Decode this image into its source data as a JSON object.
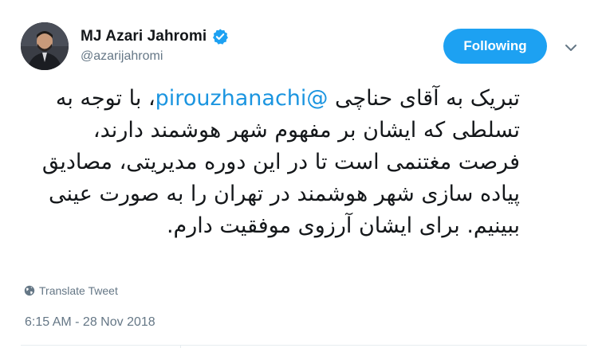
{
  "author": {
    "display_name": "MJ Azari Jahromi",
    "handle": "@azarijahromi",
    "verified": true,
    "verified_icon": "verified-badge-icon",
    "avatar_icon": "profile-photo"
  },
  "actions": {
    "follow_label": "Following",
    "menu_icon": "chevron-down-icon"
  },
  "tweet": {
    "text_before_mention": "تبریک به آقای حناچی ",
    "mention": "@pirouzhanachi",
    "text_after_mention": "، با توجه به تسلطی که ایشان بر مفهوم شهر هوشمند دارند، فرصت مغتنمی است تا در این دوره مدیریتی، مصادیق پیاده سازی شهر هوشمند در تهران را به صورت عینی ببینیم. برای ایشان آرزوی موفقیت دارم."
  },
  "translate": {
    "label": "Translate Tweet",
    "icon": "globe-icon"
  },
  "timestamp": "6:15 AM - 28 Nov 2018",
  "colors": {
    "accent": "#1da1f2",
    "mention": "#1b95e0",
    "secondary_text": "#657786",
    "primary_text": "#14171a",
    "divider": "#e6ecf0"
  }
}
